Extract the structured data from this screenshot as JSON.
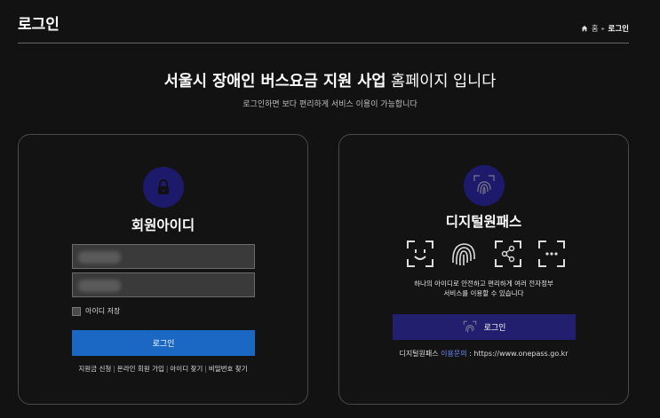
{
  "header": {
    "title": "로그인",
    "breadcrumb": {
      "home": "홈",
      "current": "로그인"
    }
  },
  "intro": {
    "headline_strong": "서울시 장애인 버스요금 지원 사업",
    "headline_rest": " 홈페이지 입니다",
    "subtitle": "로그인하면 보다 편리하게 서비스 이용이 가능합니다"
  },
  "member_login": {
    "icon": "lock-icon",
    "heading": "회원아이디",
    "id_value": "",
    "password_value": "",
    "remember_label": "아이디 저장",
    "remember_checked": false,
    "login_label": "로그인",
    "links": [
      "지원금 신청",
      "온라인 회원 가입",
      "아이디 찾기",
      "비밀번호 찾기"
    ]
  },
  "digital_pass": {
    "icon": "fingerprint-icon",
    "heading": "디지털원패스",
    "methods": [
      "face-icon",
      "fingerprint-icon",
      "pattern-icon",
      "pin-icon"
    ],
    "description_line1": "하나의 아이디로 안전하고 편리하게 여러 전자정부",
    "description_line2": "서비스를 이용할 수 있습니다",
    "login_label": "로그인",
    "contact_prefix": "디지털원패스 ",
    "contact_label": "이용문의",
    "contact_value": " : https://www.onepass.go.kr"
  },
  "colors": {
    "background": "#121212",
    "primary_button": "#1a68c4",
    "pass_button": "#22206e",
    "icon_circle": "#1d1a6b",
    "link_highlight": "#6d8bff"
  }
}
